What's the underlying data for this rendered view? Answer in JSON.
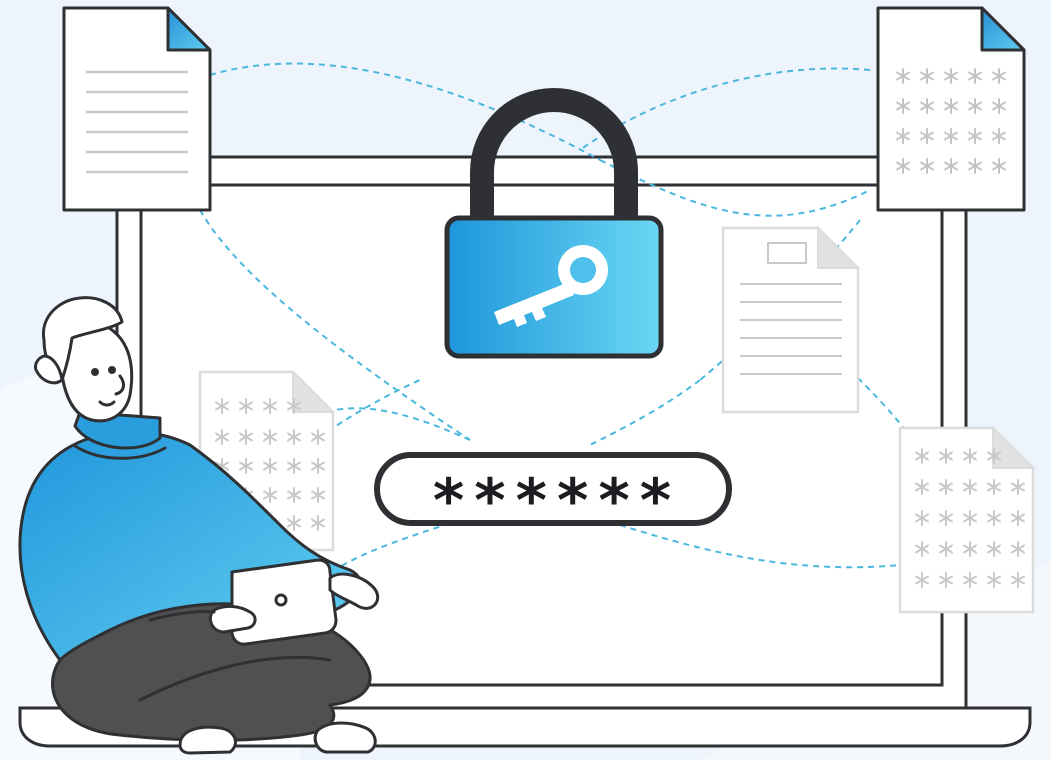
{
  "password_field": {
    "masked_value": "******"
  },
  "icons": [
    "plain-text-document-icon",
    "encrypted-document-icon",
    "padlock-icon",
    "key-icon",
    "faded-text-document-icon",
    "faded-encrypted-document-icon",
    "person-with-tablet-icon"
  ],
  "colors": {
    "background": "#edf4fb",
    "outline": "#2e3033",
    "accent_blue": "#2aa3e0",
    "accent_blue_light": "#68d4f2",
    "connector_dash": "#49b7de",
    "faded_outline": "#d9d9d9",
    "faded_symbol": "#c9c9c9",
    "pants_gray": "#505050"
  }
}
